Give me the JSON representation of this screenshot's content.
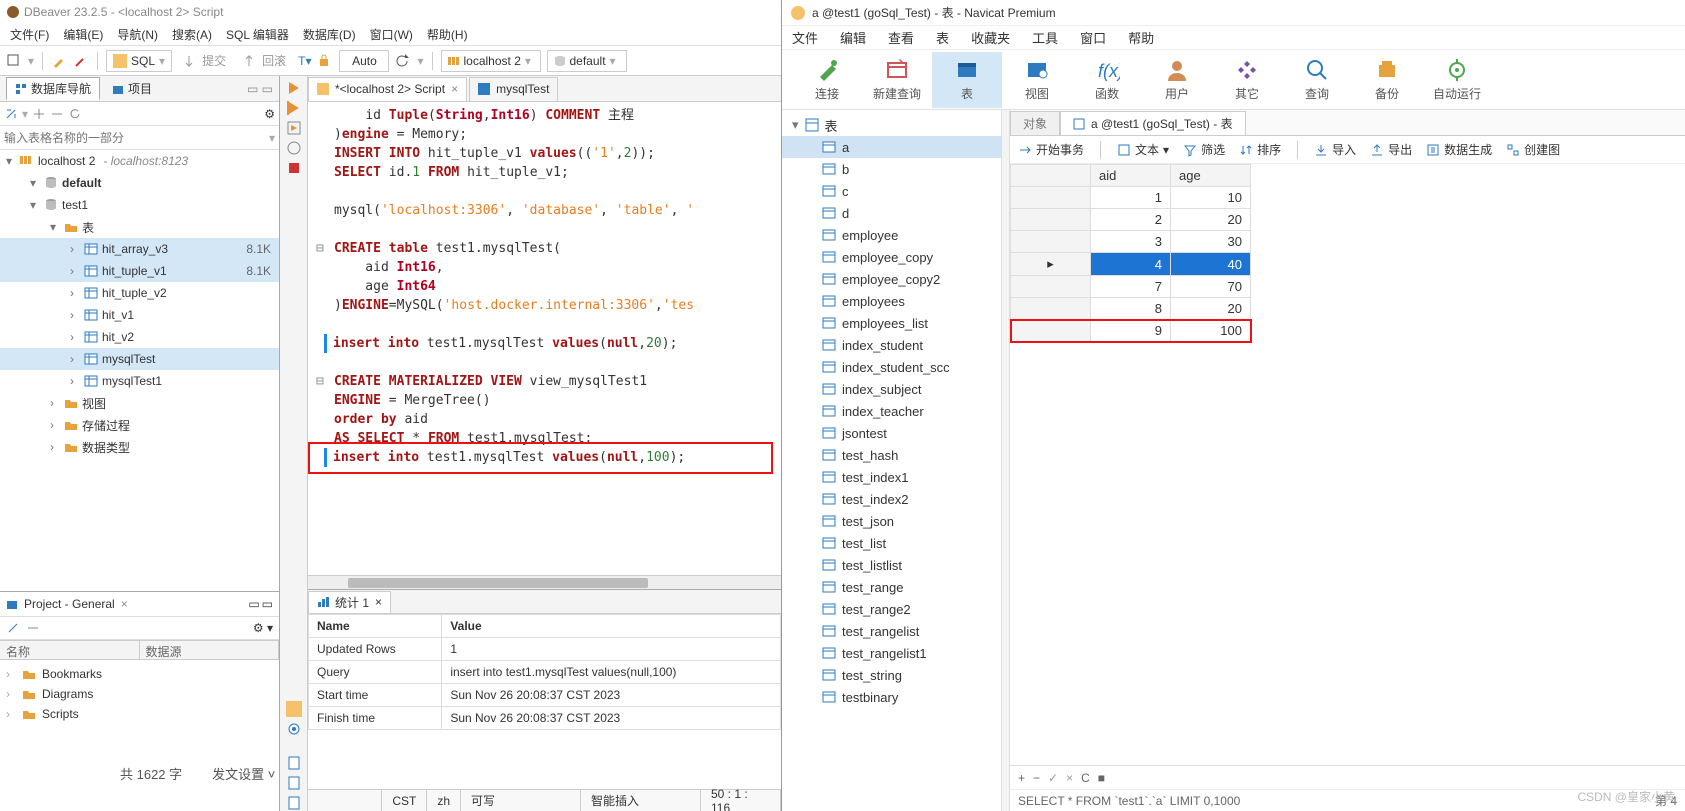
{
  "dbeaver": {
    "title": "DBeaver 23.2.5 - <localhost 2> Script",
    "menus": [
      "文件(F)",
      "编辑(E)",
      "导航(N)",
      "搜索(A)",
      "SQL 编辑器",
      "数据库(D)",
      "窗口(W)",
      "帮助(H)"
    ],
    "toolbar": {
      "sql": "SQL",
      "submit": "提交",
      "rollback": "回滚",
      "auto": "Auto",
      "conn": "localhost 2",
      "db": "default"
    },
    "leftTabs": {
      "nav": "数据库导航",
      "proj": "项目"
    },
    "filterPlaceholder": "输入表格名称的一部分",
    "tree": {
      "conn": "localhost 2",
      "connHint": "localhost:8123",
      "nodes": [
        {
          "indent": 20,
          "twisty": "▾",
          "icon": "schema",
          "text": "default",
          "bold": true
        },
        {
          "indent": 20,
          "twisty": "▾",
          "icon": "schema",
          "text": "test1"
        },
        {
          "indent": 40,
          "twisty": "▾",
          "icon": "folder",
          "text": "表"
        },
        {
          "indent": 60,
          "twisty": "›",
          "icon": "table",
          "text": "hit_array_v3",
          "size": "8.1K",
          "sel": true
        },
        {
          "indent": 60,
          "twisty": "›",
          "icon": "table",
          "text": "hit_tuple_v1",
          "size": "8.1K",
          "sel": true
        },
        {
          "indent": 60,
          "twisty": "›",
          "icon": "table",
          "text": "hit_tuple_v2"
        },
        {
          "indent": 60,
          "twisty": "›",
          "icon": "table",
          "text": "hit_v1"
        },
        {
          "indent": 60,
          "twisty": "›",
          "icon": "table",
          "text": "hit_v2"
        },
        {
          "indent": 60,
          "twisty": "›",
          "icon": "table",
          "text": "mysqlTest",
          "sel": true
        },
        {
          "indent": 60,
          "twisty": "›",
          "icon": "table",
          "text": "mysqlTest1"
        },
        {
          "indent": 40,
          "twisty": "›",
          "icon": "folder",
          "text": "视图"
        },
        {
          "indent": 40,
          "twisty": "›",
          "icon": "folder",
          "text": "存储过程"
        },
        {
          "indent": 40,
          "twisty": "›",
          "icon": "folder",
          "text": "数据类型"
        }
      ]
    },
    "project": {
      "title": "Project - General",
      "cols": [
        "名称",
        "数据源"
      ],
      "items": [
        "Bookmarks",
        "Diagrams",
        "Scripts"
      ]
    },
    "editorTabs": [
      {
        "label": "*<localhost 2> Script",
        "icon": "sql"
      },
      {
        "label": "mysqlTest",
        "icon": "table"
      }
    ],
    "resultsTab": "统计 1",
    "results": {
      "cols": [
        "Name",
        "Value"
      ],
      "rows": [
        [
          "Updated Rows",
          "1"
        ],
        [
          "Query",
          "insert into test1.mysqlTest values(null,100)"
        ],
        [
          "Start time",
          "Sun Nov 26 20:08:37 CST 2023"
        ],
        [
          "Finish time",
          "Sun Nov 26 20:08:37 CST 2023"
        ]
      ]
    },
    "status": {
      "enc": "CST",
      "lang": "zh",
      "mode": "可写",
      "insert": "智能插入",
      "pos": "50 : 1 : 116"
    },
    "footerWords": "共 1622 字",
    "footerSend": "发文设置"
  },
  "navicat": {
    "title": "a @test1 (goSql_Test) - 表 - Navicat Premium",
    "menus": [
      "文件",
      "编辑",
      "查看",
      "表",
      "收藏夹",
      "工具",
      "窗口",
      "帮助"
    ],
    "toolbar": [
      {
        "id": "conn",
        "label": "连接"
      },
      {
        "id": "query",
        "label": "新建查询"
      },
      {
        "id": "table",
        "label": "表",
        "active": true
      },
      {
        "id": "view",
        "label": "视图"
      },
      {
        "id": "func",
        "label": "函数"
      },
      {
        "id": "user",
        "label": "用户"
      },
      {
        "id": "other",
        "label": "其它"
      },
      {
        "id": "querybtn",
        "label": "查询"
      },
      {
        "id": "backup",
        "label": "备份"
      },
      {
        "id": "auto",
        "label": "自动运行"
      }
    ],
    "treeHead": "表",
    "tables": [
      "a",
      "b",
      "c",
      "d",
      "employee",
      "employee_copy",
      "employee_copy2",
      "employees",
      "employees_list",
      "index_student",
      "index_student_scc",
      "index_subject",
      "index_teacher",
      "jsontest",
      "test_hash",
      "test_index1",
      "test_index2",
      "test_json",
      "test_list",
      "test_listlist",
      "test_range",
      "test_range2",
      "test_rangelist",
      "test_rangelist1",
      "test_string",
      "testbinary"
    ],
    "selTable": "a",
    "tabs": {
      "objects": "对象",
      "main": "a @test1 (goSql_Test) - 表"
    },
    "actions": {
      "begin": "开始事务",
      "text": "文本",
      "filter": "筛选",
      "sort": "排序",
      "import": "导入",
      "export": "导出",
      "gen": "数据生成",
      "diagram": "创建图"
    },
    "cols": [
      "aid",
      "age"
    ],
    "rows": [
      {
        "aid": 1,
        "age": 10
      },
      {
        "aid": 2,
        "age": 20
      },
      {
        "aid": 3,
        "age": 30
      },
      {
        "aid": 4,
        "age": 40,
        "sel": true
      },
      {
        "aid": 7,
        "age": 70
      },
      {
        "aid": 8,
        "age": 20
      },
      {
        "aid": 9,
        "age": 100,
        "red": true
      }
    ],
    "statusQuery": "SELECT * FROM `test1`.`a` LIMIT 0,1000",
    "statusRight": "第 4 "
  },
  "watermark": "CSDN @皇家小黄"
}
